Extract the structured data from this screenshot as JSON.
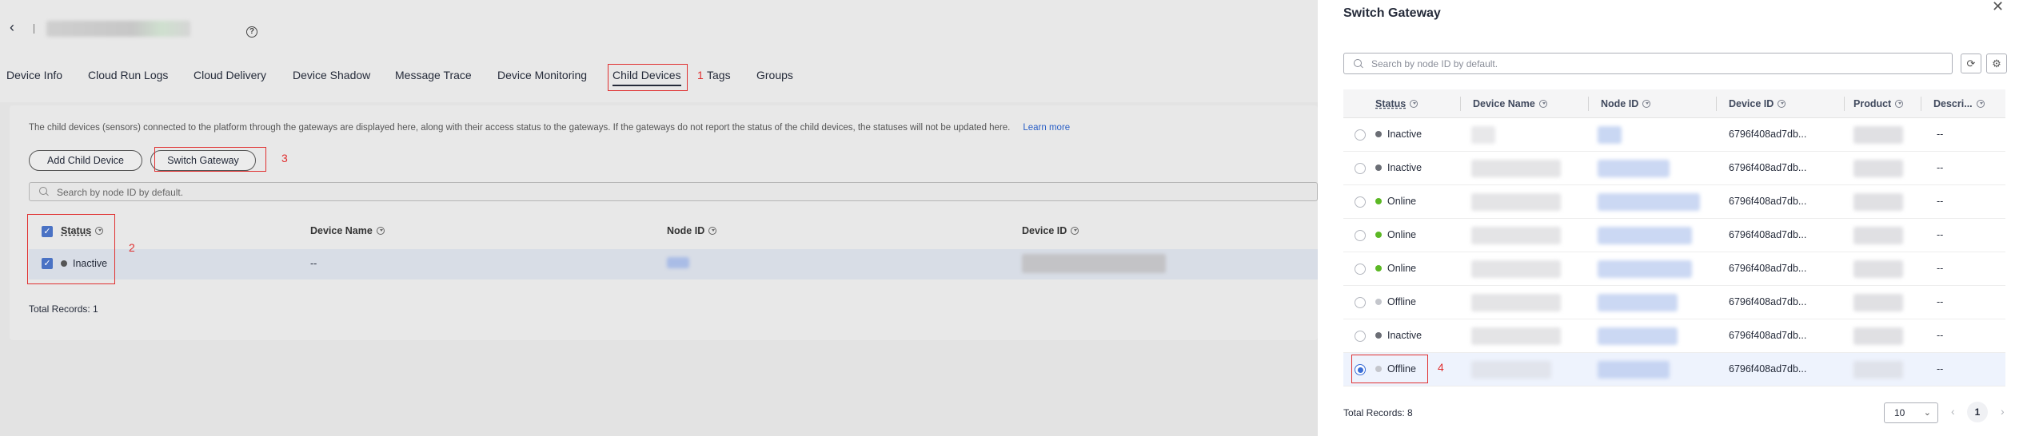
{
  "page": {
    "tabs": [
      {
        "label": "Device Info"
      },
      {
        "label": "Cloud Run Logs"
      },
      {
        "label": "Cloud Delivery"
      },
      {
        "label": "Device Shadow"
      },
      {
        "label": "Message Trace"
      },
      {
        "label": "Device Monitoring"
      },
      {
        "label": "Child Devices"
      },
      {
        "label": "Tags"
      },
      {
        "label": "Groups"
      }
    ],
    "notice": "The child devices (sensors) connected to the platform through the gateways are displayed here, along with their access status to the gateways. If the gateways do not report the status of the child devices, the statuses will not be updated here.",
    "learn_more": "Learn more",
    "add_child_device": "Add Child Device",
    "switch_gateway": "Switch Gateway",
    "search_placeholder": "Search by node ID by default.",
    "columns": {
      "status": "Status",
      "device_name": "Device Name",
      "node_id": "Node ID",
      "device_id": "Device ID"
    },
    "row": {
      "status": "Inactive",
      "status_color": "#555555",
      "device_name": "--"
    },
    "total": "Total Records: 1"
  },
  "annotations": {
    "n1": "1",
    "n2": "2",
    "n3": "3",
    "n4": "4"
  },
  "drawer": {
    "title": "Switch Gateway",
    "search_placeholder": "Search by node ID by default.",
    "columns": {
      "status": "Status",
      "device_name": "Device Name",
      "node_id": "Node ID",
      "device_id": "Device ID",
      "product": "Product",
      "description": "Descri..."
    },
    "rows": [
      {
        "status": "Inactive",
        "color": "#6b6e75",
        "device_id": "6796f408ad7db...",
        "description": "--"
      },
      {
        "status": "Inactive",
        "color": "#6b6e75",
        "device_id": "6796f408ad7db...",
        "description": "--"
      },
      {
        "status": "Online",
        "color": "#5cb825",
        "device_id": "6796f408ad7db...",
        "description": "--"
      },
      {
        "status": "Online",
        "color": "#5cb825",
        "device_id": "6796f408ad7db...",
        "description": "--"
      },
      {
        "status": "Online",
        "color": "#5cb825",
        "device_id": "6796f408ad7db...",
        "description": "--"
      },
      {
        "status": "Offline",
        "color": "#c4c6cc",
        "device_id": "6796f408ad7db...",
        "description": "--"
      },
      {
        "status": "Inactive",
        "color": "#6b6e75",
        "device_id": "6796f408ad7db...",
        "description": "--"
      },
      {
        "status": "Offline",
        "color": "#c4c6cc",
        "device_id": "6796f408ad7db...",
        "description": "--",
        "selected": true
      }
    ],
    "total": "Total Records: 8",
    "page_size": "10",
    "current_page": "1"
  }
}
